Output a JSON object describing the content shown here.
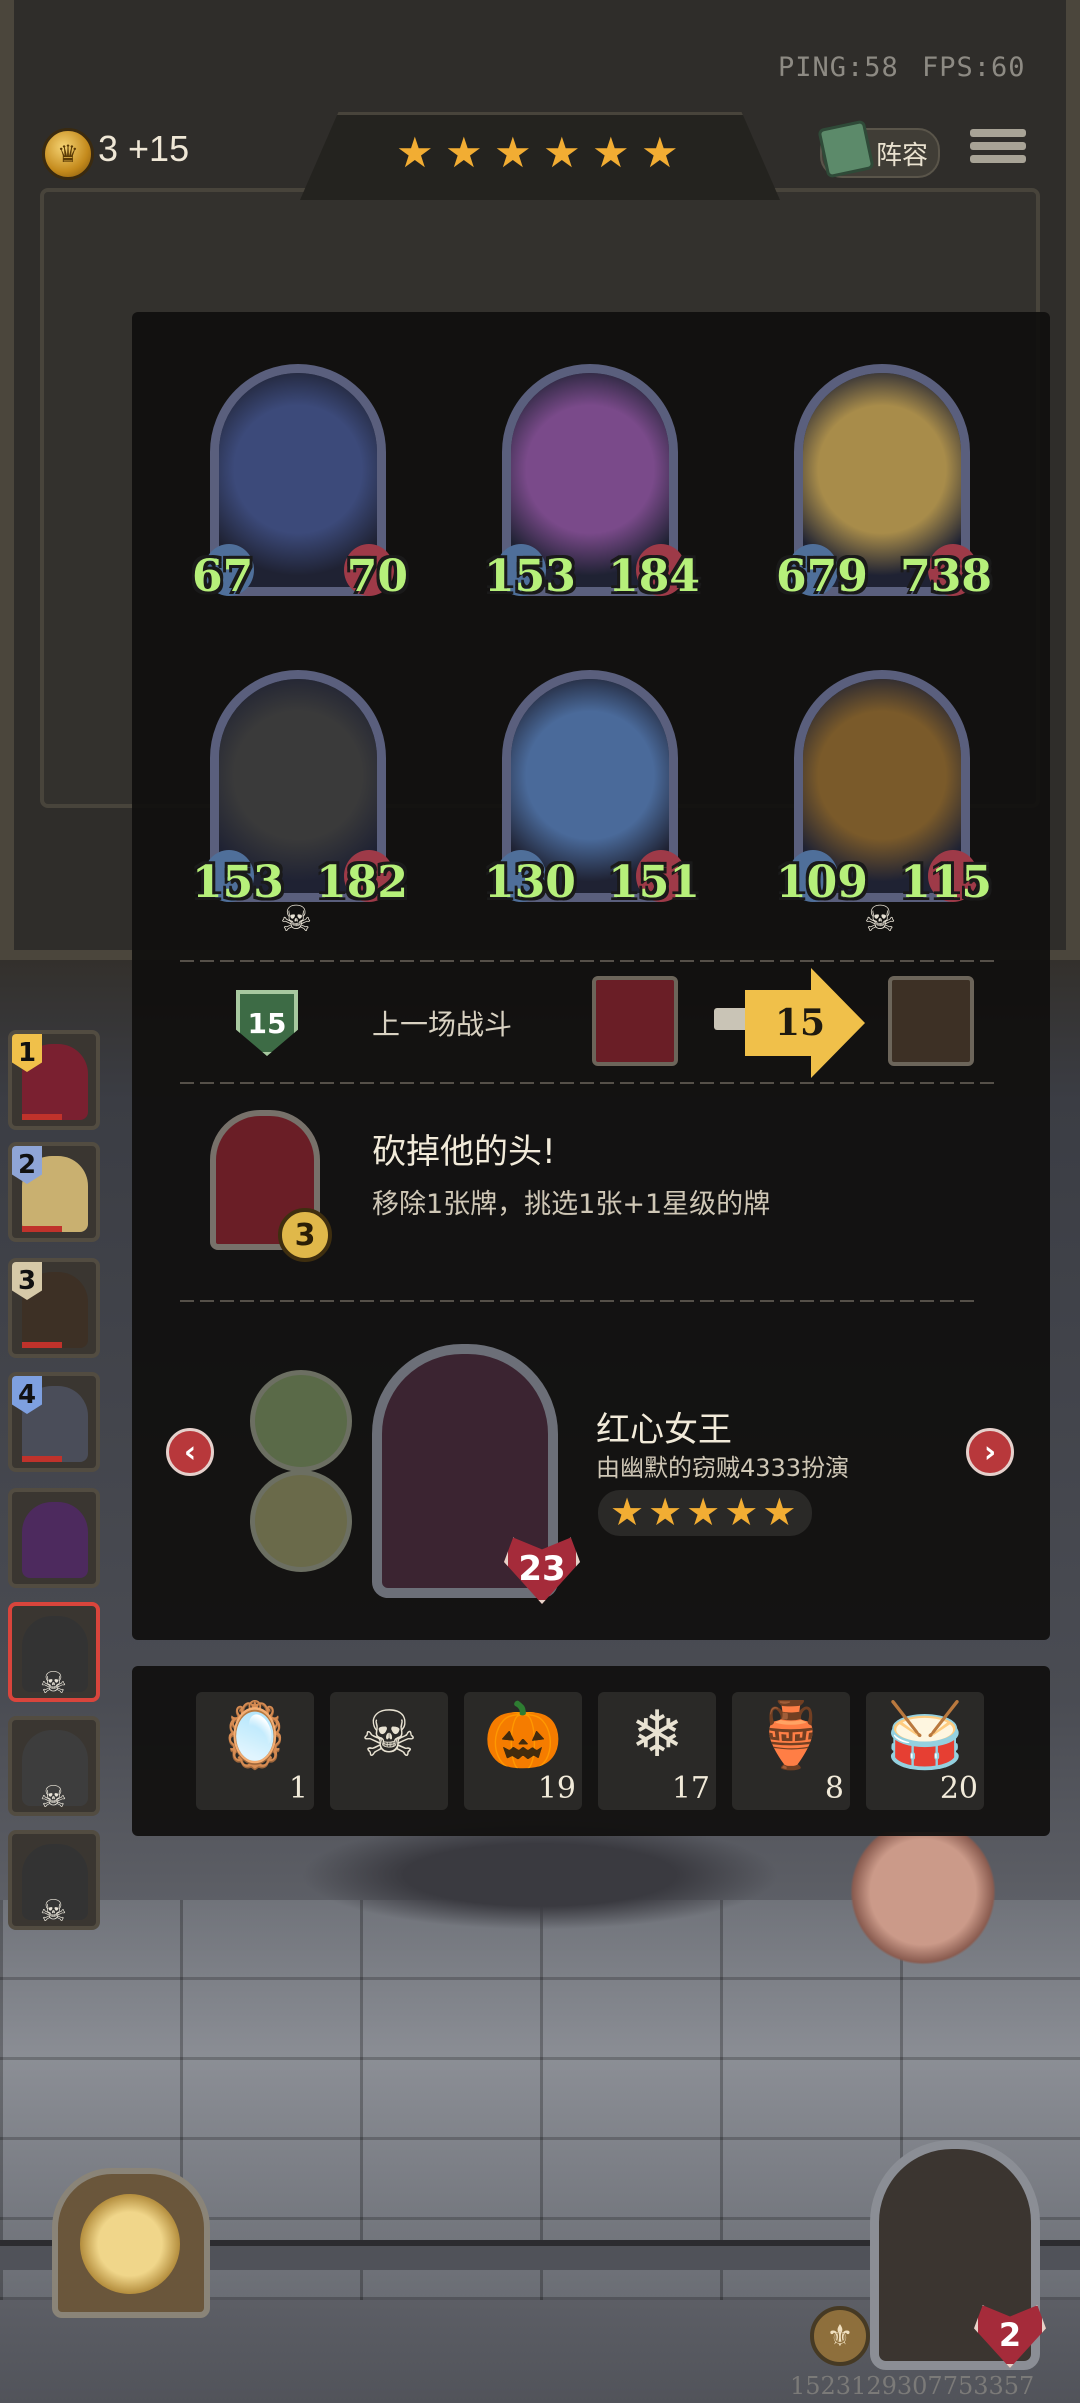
{
  "hud": {
    "ping": "PING:58",
    "fps": "FPS:60",
    "gold": "3 +15",
    "tavern_stars": 6,
    "lineup_label": "阵容"
  },
  "roster": [
    {
      "badge": "1",
      "badge_color": "#f0c04a",
      "face_color": "#7a2030",
      "dead": false
    },
    {
      "badge": "2",
      "badge_color": "#8fa5d6",
      "face_color": "#c9b070",
      "dead": false
    },
    {
      "badge": "3",
      "badge_color": "#d6c9a8",
      "face_color": "#3d3025",
      "dead": false
    },
    {
      "badge": "4",
      "badge_color": "#7ea0e0",
      "face_color": "#4a4d59",
      "dead": false
    },
    {
      "badge": "",
      "badge_color": "",
      "face_color": "#4d2a5e",
      "dead": false
    },
    {
      "badge": "",
      "badge_color": "",
      "face_color": "#555",
      "dead": true,
      "selected": true
    },
    {
      "badge": "",
      "badge_color": "",
      "face_color": "#666",
      "dead": true
    },
    {
      "badge": "",
      "badge_color": "",
      "face_color": "#555",
      "dead": true
    }
  ],
  "warband": [
    {
      "attack": "67",
      "health": "70",
      "color": "#3c4a7a",
      "skull": false
    },
    {
      "attack": "153",
      "health": "184",
      "color": "#7a4a8a",
      "skull": false
    },
    {
      "attack": "679",
      "health": "738",
      "color": "#a88c4a",
      "skull": false
    },
    {
      "attack": "153",
      "health": "182",
      "color": "#3a3a3a",
      "skull": true
    },
    {
      "attack": "130",
      "health": "151",
      "color": "#4a6a9a",
      "skull": false
    },
    {
      "attack": "109",
      "health": "115",
      "color": "#7a5a2a",
      "skull": true
    }
  ],
  "last_battle": {
    "tier": "15",
    "label": "上一场战斗",
    "damage": "15"
  },
  "hero_power": {
    "name": "砍掉他的头!",
    "description": "移除1张牌，挑选1张+1星级的牌",
    "level": "3"
  },
  "hero": {
    "name": "红心女王",
    "player": "由幽默的窃贼4333扮演",
    "stars": 5,
    "health": "23"
  },
  "trinkets": [
    {
      "icon": "mirror-icon",
      "glyph": "🪞",
      "count": "1"
    },
    {
      "icon": "skull-mask-icon",
      "glyph": "☠",
      "count": ""
    },
    {
      "icon": "pumpkin-icon",
      "glyph": "🎃",
      "count": "19"
    },
    {
      "icon": "snowflake-icon",
      "glyph": "❄",
      "count": "17"
    },
    {
      "icon": "treasure-bowl-icon",
      "glyph": "🏺",
      "count": "8"
    },
    {
      "icon": "drum-icon",
      "glyph": "🥁",
      "count": "20"
    }
  ],
  "player": {
    "health": "2",
    "session_id": "1523129307753357"
  }
}
